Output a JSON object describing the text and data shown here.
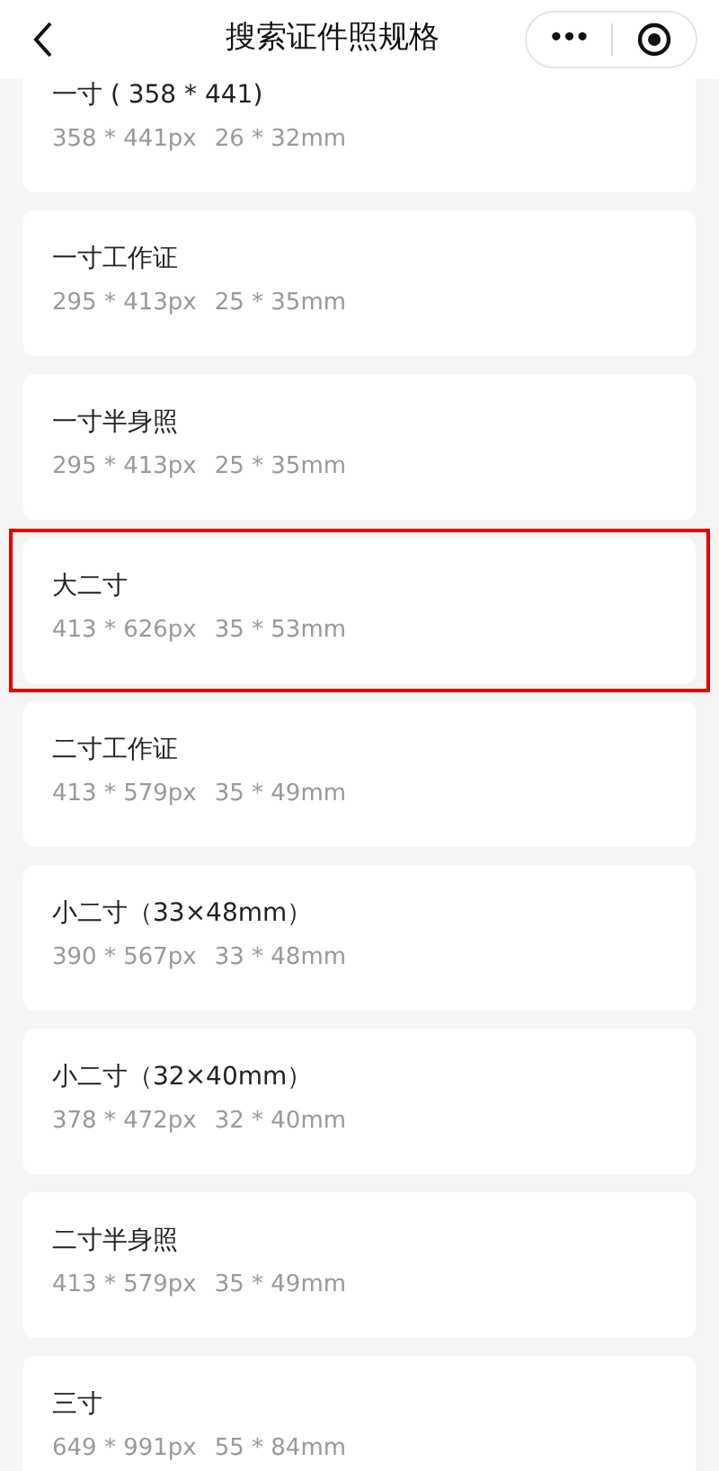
{
  "header": {
    "title": "搜索证件照规格",
    "more": "•••"
  },
  "items": [
    {
      "name": "一寸 ( 358 * 441)",
      "pixels": "358 * 441px",
      "size": "26 * 32mm",
      "selected": false
    },
    {
      "name": "一寸工作证",
      "pixels": "295 * 413px",
      "size": "25 * 35mm",
      "selected": false
    },
    {
      "name": "一寸半身照",
      "pixels": "295 * 413px",
      "size": "25 * 35mm",
      "selected": false
    },
    {
      "name": "大二寸",
      "pixels": "413 * 626px",
      "size": "35 * 53mm",
      "selected": true
    },
    {
      "name": "二寸工作证",
      "pixels": "413 * 579px",
      "size": "35 * 49mm",
      "selected": false
    },
    {
      "name": "小二寸（33×48mm）",
      "pixels": "390 * 567px",
      "size": "33 * 48mm",
      "selected": false
    },
    {
      "name": "小二寸（32×40mm）",
      "pixels": "378 * 472px",
      "size": "32 * 40mm",
      "selected": false
    },
    {
      "name": "二寸半身照",
      "pixels": "413 * 579px",
      "size": "35 * 49mm",
      "selected": false
    },
    {
      "name": "三寸",
      "pixels": "649 * 991px",
      "size": "55 * 84mm",
      "selected": false
    }
  ]
}
